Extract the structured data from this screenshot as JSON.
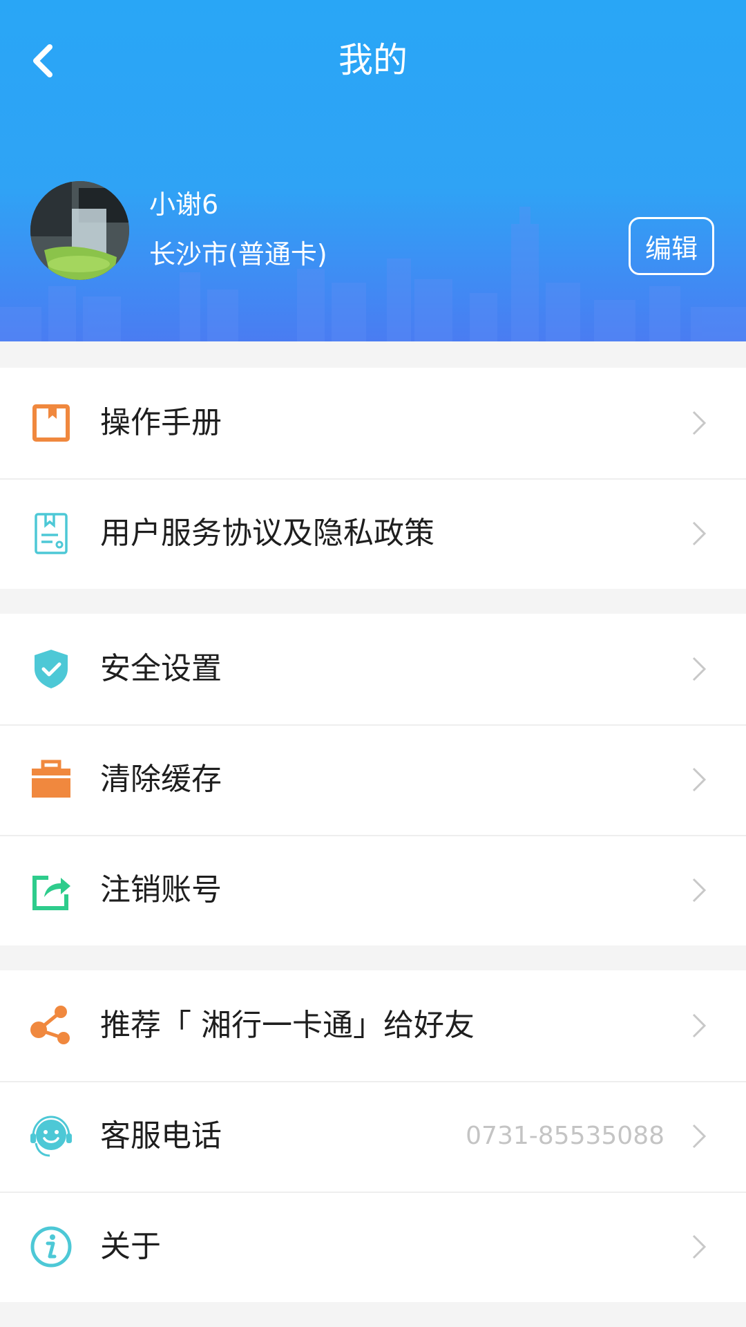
{
  "header": {
    "title": "我的",
    "back_icon": "chevron-left-icon"
  },
  "profile": {
    "name": "小谢6",
    "city": "长沙市(普通卡)",
    "edit_label": "编辑"
  },
  "colors": {
    "header_blue": "#2fa3f5",
    "orange": "#f0883e",
    "teal": "#4dc8d6",
    "green": "#2ecc8c"
  },
  "menu": {
    "manual": {
      "label": "操作手册",
      "icon": "book-icon"
    },
    "agreement": {
      "label": "用户服务协议及隐私政策",
      "icon": "document-icon"
    },
    "security": {
      "label": "安全设置",
      "icon": "shield-check-icon"
    },
    "cache": {
      "label": "清除缓存",
      "icon": "briefcase-icon"
    },
    "cancel": {
      "label": "注销账号",
      "icon": "share-box-icon"
    },
    "recommend": {
      "label": "推荐「 湘行一卡通」给好友",
      "icon": "share-nodes-icon"
    },
    "service": {
      "label": "客服电话",
      "value": "0731-85535088",
      "icon": "support-agent-icon"
    },
    "about": {
      "label": "关于",
      "icon": "info-icon"
    }
  }
}
